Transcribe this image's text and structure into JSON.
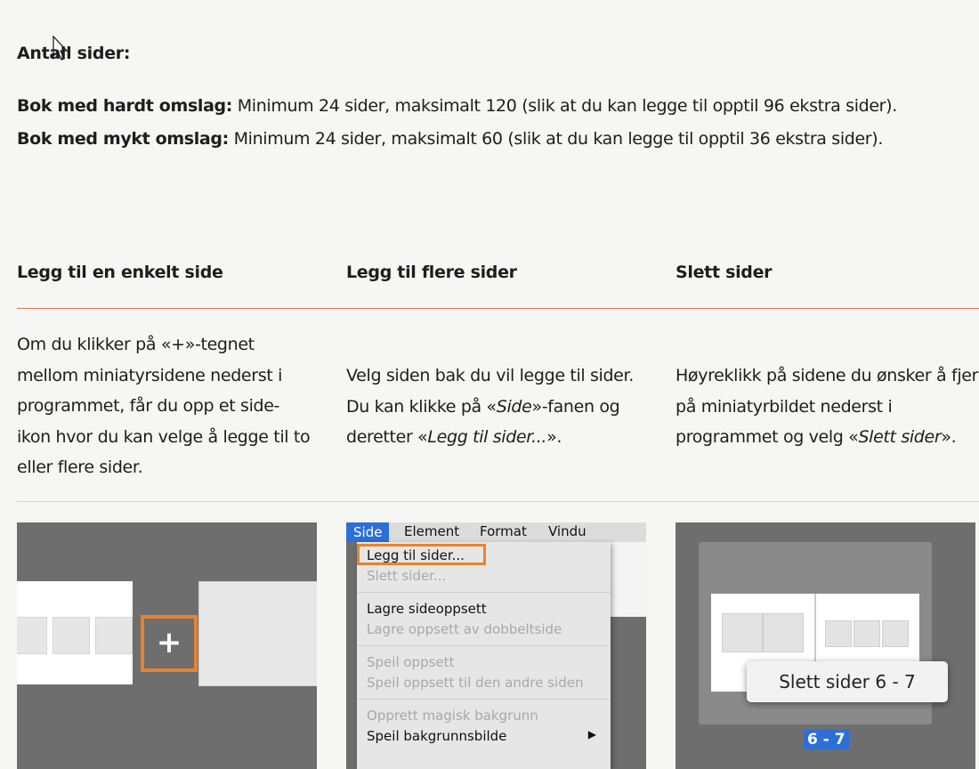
{
  "page_count": {
    "heading": "Antall sider:",
    "hard_cover_label": "Bok med hardt omslag:",
    "hard_cover_text": " Minimum 24 sider, maksimalt 120 (slik at du kan legge til opptil 96 ekstra sider).",
    "soft_cover_label": "Bok med mykt omslag:",
    "soft_cover_text": " Minimum 24 sider, maksimalt 60 (slik at du kan legge til opptil 36 ekstra sider)."
  },
  "columns": [
    {
      "heading": "Legg til en enkelt side",
      "lines": [
        "Om du klikker på «+»-tegnet",
        "mellom miniatyrsidene nederst i",
        "programmet, får du opp et side-",
        "ikon hvor du kan velge å legge til to",
        "eller flere sider."
      ]
    },
    {
      "heading": "Legg til flere sider",
      "line1": "Velg siden bak du vil legge til sider.",
      "line2_pre": "Du kan klikke på «",
      "line2_em": "Side",
      "line2_post": "»-fanen og",
      "line3_pre": "deretter «",
      "line3_em": "Legg til sider...",
      "line3_post": "»."
    },
    {
      "heading": "Slett sider",
      "line1": "Høyreklikk på sidene du ønsker å fjerne",
      "line2": "på miniatyrbildet nederst i",
      "line3_pre": "programmet og velg «",
      "line3_em": "Slett sider",
      "line3_post": "»."
    }
  ],
  "image1": {
    "plus_symbol": "+"
  },
  "image2": {
    "menubar": [
      "Side",
      "Element",
      "Format",
      "Vindu"
    ],
    "items": [
      {
        "label": "Legg til sider...",
        "enabled": true,
        "highlighted": true
      },
      {
        "label": "Slett sider...",
        "enabled": false
      },
      {
        "label": "Lagre sideoppsett",
        "enabled": true
      },
      {
        "label": "Lagre oppsett av dobbeltside",
        "enabled": false
      },
      {
        "label": "Speil oppsett",
        "enabled": false
      },
      {
        "label": "Speil oppsett til den andre siden",
        "enabled": false
      },
      {
        "label": "Opprett magisk bakgrunn",
        "enabled": false
      },
      {
        "label": "Speil bakgrunnsbilde",
        "enabled": true
      }
    ],
    "submenu_arrow": "▶"
  },
  "image3": {
    "popup_label": "Slett sider 6 - 7",
    "page_label": "6 - 7"
  },
  "colors": {
    "accent_orange": "#e8822f",
    "rule_orange": "#e07a4a",
    "selection_blue": "#2d6fd8",
    "background": "#f6f6f5"
  }
}
